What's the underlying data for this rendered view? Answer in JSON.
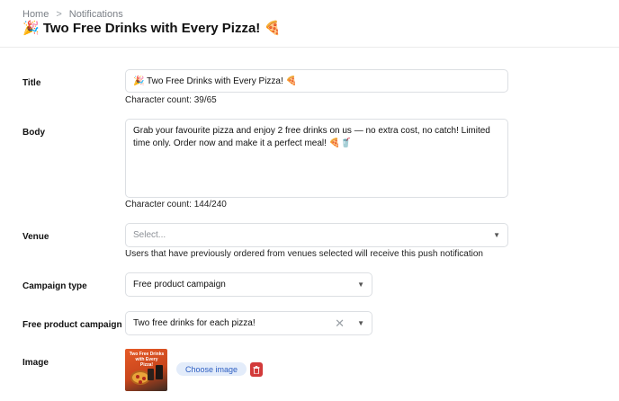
{
  "breadcrumb": {
    "home": "Home",
    "separator": ">",
    "current": "Notifications"
  },
  "page_title": "🎉 Two Free Drinks with Every Pizza! 🍕",
  "form": {
    "title": {
      "label": "Title",
      "value": "🎉 Two Free Drinks with Every Pizza! 🍕",
      "char_count": "Character count: 39/65"
    },
    "body": {
      "label": "Body",
      "value": "Grab your favourite pizza and enjoy 2 free drinks on us — no extra cost, no catch! Limited time only. Order now and make it a perfect meal! 🍕🥤",
      "char_count": "Character count: 144/240"
    },
    "venue": {
      "label": "Venue",
      "placeholder": "Select...",
      "help": "Users that have previously ordered from venues selected will receive this push notification"
    },
    "campaign_type": {
      "label": "Campaign type",
      "selected": "Free product campaign"
    },
    "free_product_campaign": {
      "label": "Free product campaign",
      "selected": "Two free drinks for each pizza!"
    },
    "image": {
      "label": "Image",
      "thumbnail_text": "Two Free Drinks with Every Pizza!",
      "choose_label": "Choose image",
      "delete_icon": "trash-icon"
    }
  },
  "icons": {
    "caret": "▼",
    "clear": "✕"
  },
  "colors": {
    "accent": "#2d5ec2",
    "danger": "#d23a3a",
    "thumbnail": "#e65a27"
  }
}
